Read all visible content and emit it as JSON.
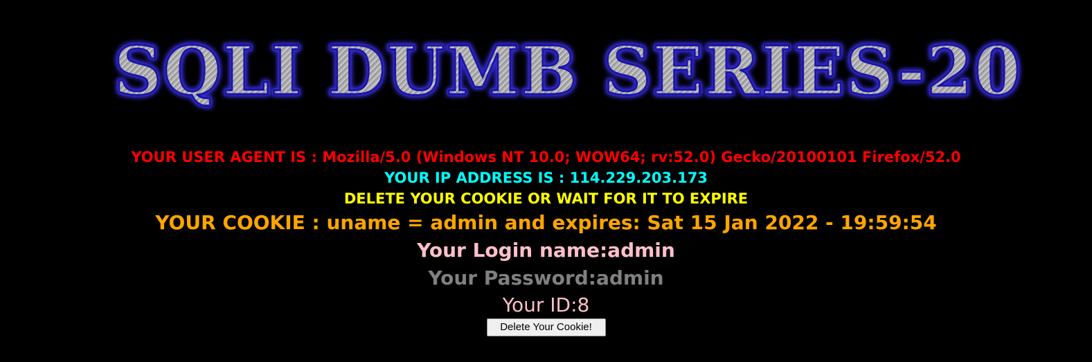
{
  "banner": {
    "title": "SQLI DUMB SERIES-20"
  },
  "info": {
    "user_agent": "YOUR USER AGENT IS : Mozilla/5.0 (Windows NT 10.0; WOW64; rv:52.0) Gecko/20100101 Firefox/52.0",
    "ip_address": "YOUR IP ADDRESS IS : 114.229.203.173",
    "delete_notice": "DELETE YOUR COOKIE OR WAIT FOR IT TO EXPIRE",
    "cookie": "YOUR COOKIE : uname = admin and expires: Sat 15 Jan 2022 - 19:59:54",
    "login_name": "Your Login name:admin",
    "password": "Your Password:admin",
    "id": "Your ID:8"
  },
  "actions": {
    "delete_cookie_label": "Delete Your Cookie!"
  },
  "colors": {
    "background": "#000000",
    "user_agent": "#ff0000",
    "ip_address": "#00ffff",
    "delete_notice": "#ffff00",
    "cookie": "#ffa500",
    "login_name": "#ffc0cb",
    "password": "#808080",
    "id": "#ffc0cb"
  }
}
